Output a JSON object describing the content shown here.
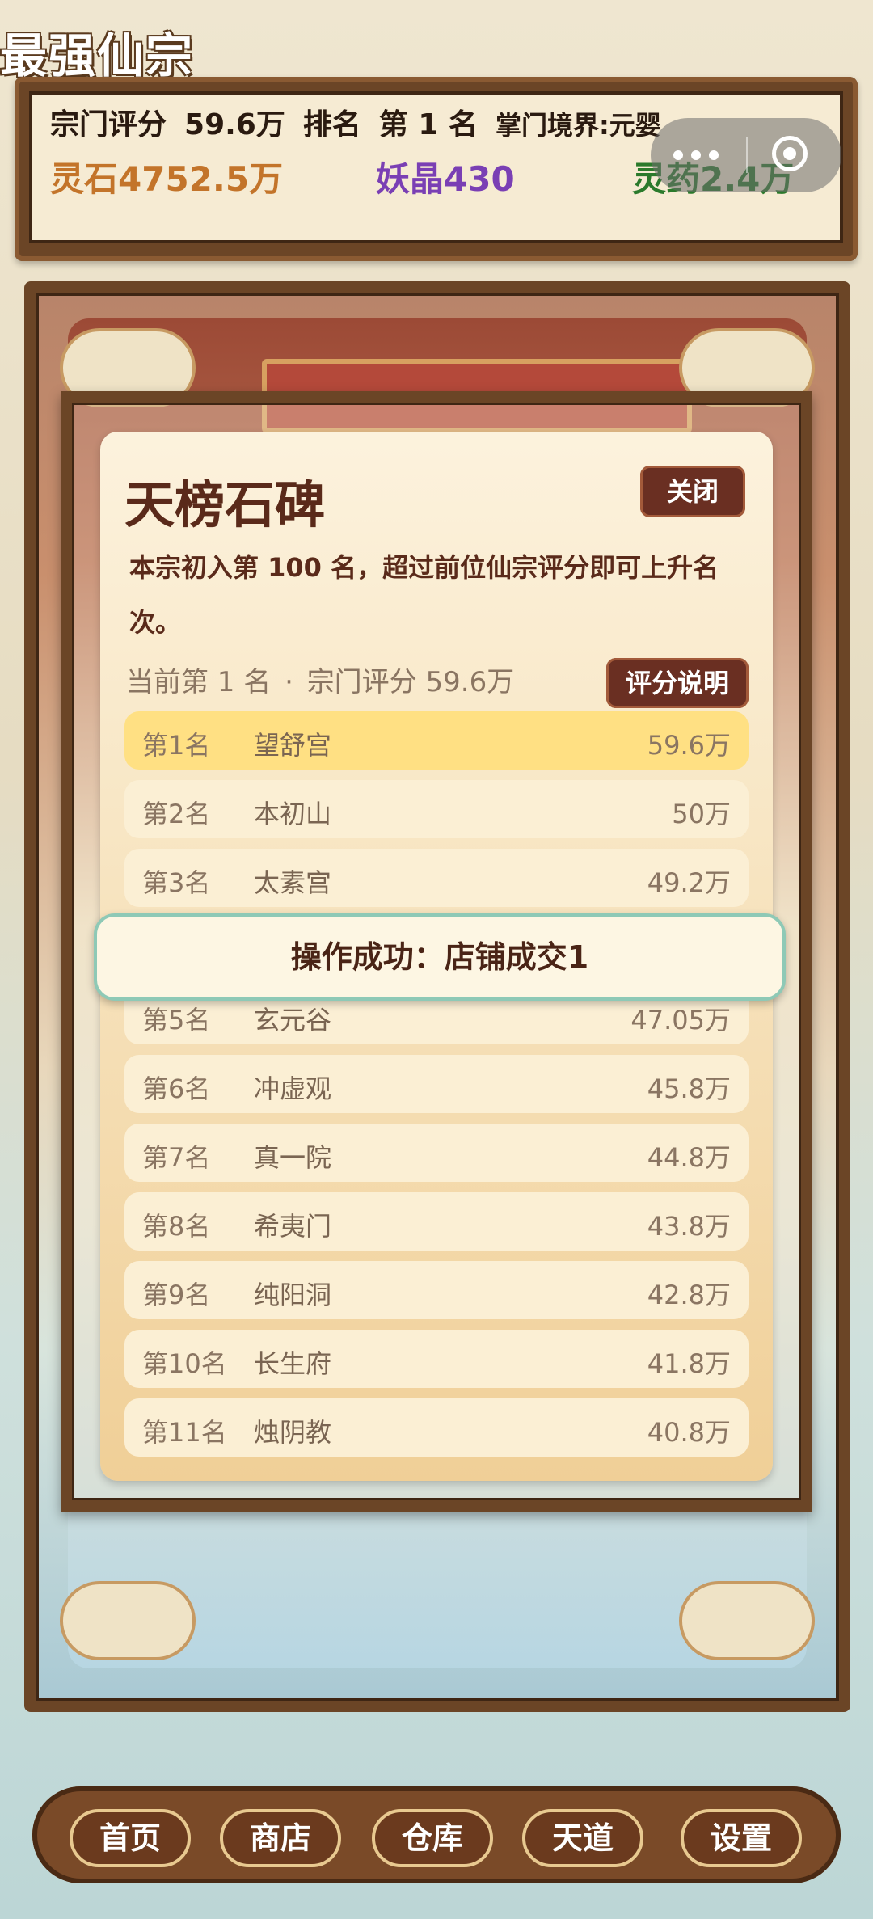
{
  "app_title": "最强仙宗",
  "stats": {
    "sect_score_label": "宗门评分",
    "sect_score_value": "59.6万",
    "rank_label": "排名",
    "rank_value": "第 1 名",
    "realm": "掌门境界:元婴"
  },
  "resources": {
    "spirit_stone": "灵石4752.5万",
    "demon_crystal": "妖晶430",
    "spirit_herb": "灵药2.4万"
  },
  "modal": {
    "title": "天榜石碑",
    "close_label": "关闭",
    "description": "本宗初入第 100 名，超过前位仙宗评分即可上升名次。",
    "current_rank": "当前第 1 名",
    "separator": "·",
    "current_score": "宗门评分 59.6万",
    "score_help_label": "评分说明",
    "rankings": [
      {
        "pos": "第1名",
        "name": "望舒宫",
        "score": "59.6万"
      },
      {
        "pos": "第2名",
        "name": "本初山",
        "score": "50万"
      },
      {
        "pos": "第3名",
        "name": "太素宫",
        "score": "49.2万"
      },
      {
        "pos": "",
        "name": "",
        "score": ""
      },
      {
        "pos": "第5名",
        "name": "玄元谷",
        "score": "47.05万"
      },
      {
        "pos": "第6名",
        "name": "冲虚观",
        "score": "45.8万"
      },
      {
        "pos": "第7名",
        "name": "真一院",
        "score": "44.8万"
      },
      {
        "pos": "第8名",
        "name": "希夷门",
        "score": "43.8万"
      },
      {
        "pos": "第9名",
        "name": "纯阳洞",
        "score": "42.8万"
      },
      {
        "pos": "第10名",
        "name": "长生府",
        "score": "41.8万"
      },
      {
        "pos": "第11名",
        "name": "烛阴教",
        "score": "40.8万"
      }
    ]
  },
  "toast": "操作成功：店铺成交1",
  "nav": [
    {
      "label": "首页"
    },
    {
      "label": "商店"
    },
    {
      "label": "仓库"
    },
    {
      "label": "天道"
    },
    {
      "label": "设置"
    }
  ],
  "colors": {
    "wood": "#6b4526",
    "button_dark": "#6a2f22",
    "highlight_row": "#ffe083",
    "stone": "#c3742a",
    "crystal": "#7a3fb4",
    "herb": "#2b7a2b",
    "toast_border": "#8ec9b6"
  }
}
